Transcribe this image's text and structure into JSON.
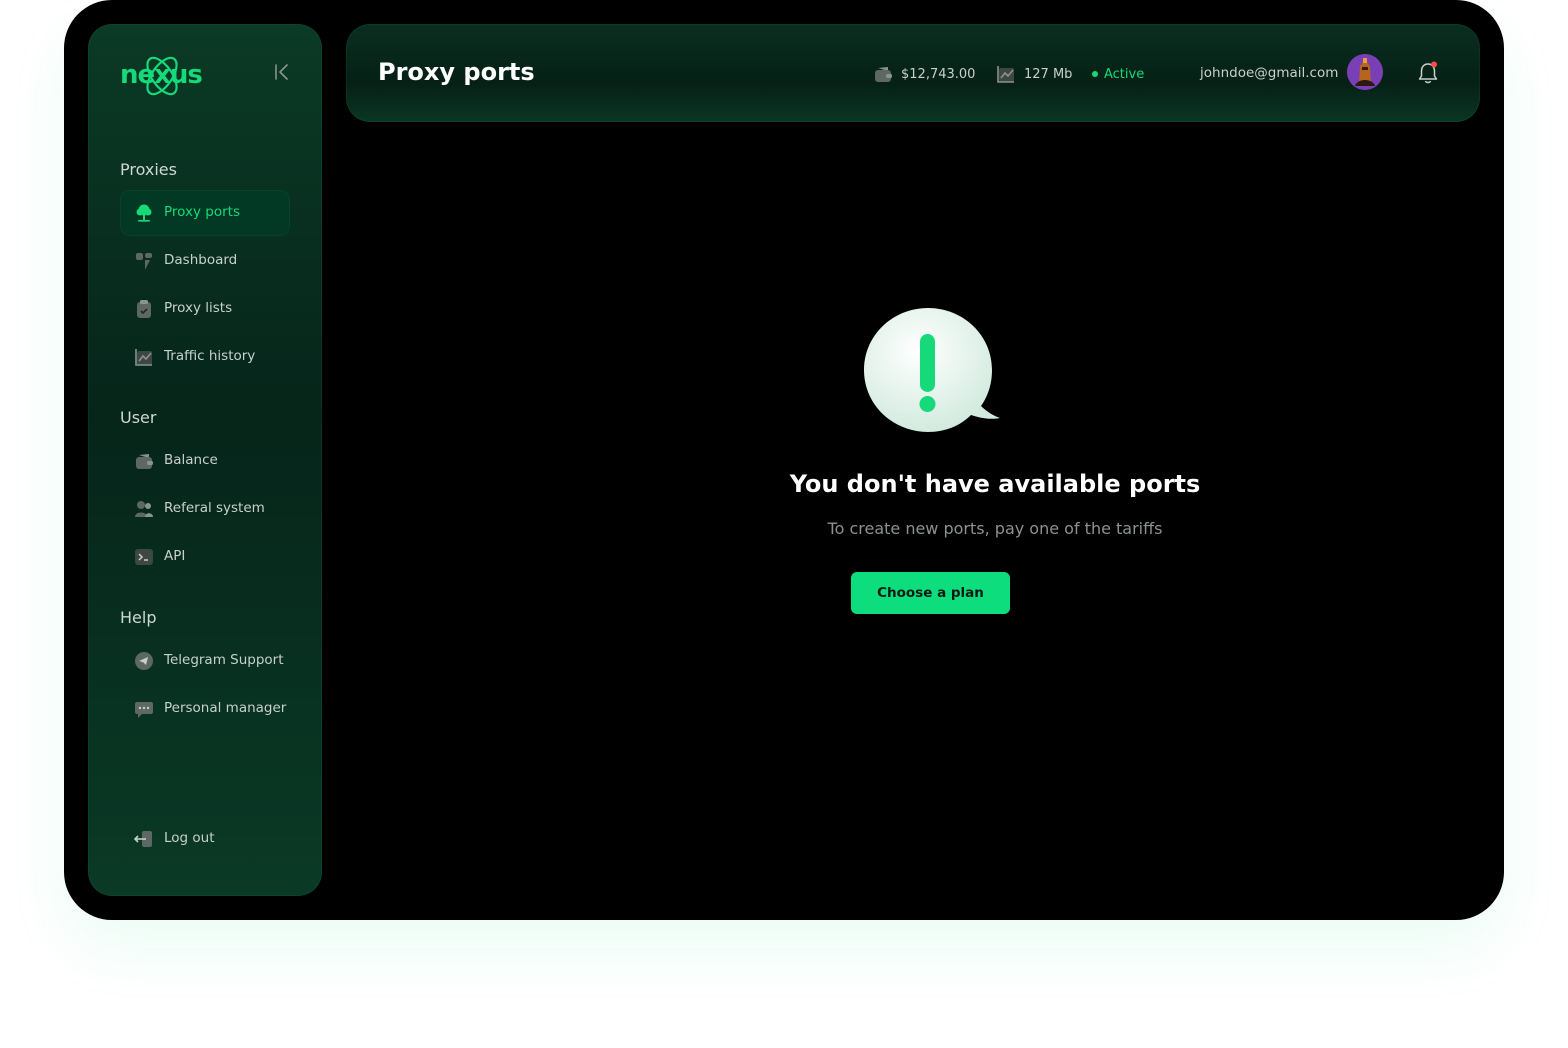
{
  "brand": {
    "logo_text": "nexus"
  },
  "sidebar": {
    "sections": [
      {
        "title": "Proxies",
        "items": [
          {
            "label": "Proxy ports",
            "icon": "proxy-tree-icon",
            "active": true
          },
          {
            "label": "Dashboard",
            "icon": "dashboard-icon"
          },
          {
            "label": "Proxy lists",
            "icon": "clipboard-check-icon"
          },
          {
            "label": "Traffic history",
            "icon": "chart-icon"
          }
        ]
      },
      {
        "title": "User",
        "items": [
          {
            "label": "Balance",
            "icon": "wallet-icon"
          },
          {
            "label": "Referal system",
            "icon": "users-icon"
          },
          {
            "label": "API",
            "icon": "terminal-icon"
          }
        ]
      },
      {
        "title": "Help",
        "items": [
          {
            "label": "Telegram Support",
            "icon": "telegram-icon"
          },
          {
            "label": "Personal manager",
            "icon": "chat-icon"
          }
        ]
      }
    ],
    "logout_label": "Log out"
  },
  "header": {
    "title": "Proxy ports",
    "balance": "$12,743.00",
    "traffic": "127 Mb",
    "status": "Active",
    "email": "johndoe@gmail.com"
  },
  "empty_state": {
    "title": "You don't have available ports",
    "subtitle": "To create new ports, pay one of the tariffs",
    "cta_label": "Choose a plan"
  },
  "colors": {
    "accent": "#16d97a",
    "button": "#0ddd7c",
    "background": "#000000",
    "sidebar": "#0b3a26",
    "notification_dot": "#ff4d4d"
  }
}
